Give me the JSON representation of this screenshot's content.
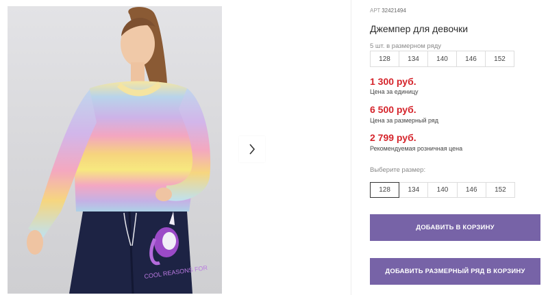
{
  "product": {
    "article_label": "АРТ",
    "article_value": "32421494",
    "title": "Джемпер для девочки",
    "row_note": "5 шт. в размерном ряду",
    "row_sizes": [
      "128",
      "134",
      "140",
      "146",
      "152"
    ]
  },
  "prices": {
    "unit_price": "1 300 руб.",
    "unit_label": "Цена за единицу",
    "row_price": "6 500 руб.",
    "row_label": "Цена за размерный ряд",
    "retail_price": "2 799 руб.",
    "retail_label": "Рекомендуемая розничная цена"
  },
  "size_picker": {
    "label": "Выберите размер:",
    "options": [
      "128",
      "134",
      "140",
      "146",
      "152"
    ],
    "selected": "128"
  },
  "buttons": {
    "add_to_cart": "ДОБАВИТЬ В КОРЗИНУ",
    "add_row_to_cart": "ДОБАВИТЬ РАЗМЕРНЫЙ РЯД В КОРЗИНУ"
  },
  "gallery": {
    "next_icon": "chevron-right-icon",
    "photo": "girl-rainbow-sweater-photo",
    "print_text": "COOL REASONS FOR"
  },
  "colors": {
    "price": "#d5242b",
    "button": "#7763a7",
    "sweater_pink": "#f2a3bb",
    "sweater_yellow": "#f7e27e",
    "sweater_lilac": "#c9b1e6",
    "pants": "#1d2344",
    "unicorn": "#9b4ac7"
  }
}
